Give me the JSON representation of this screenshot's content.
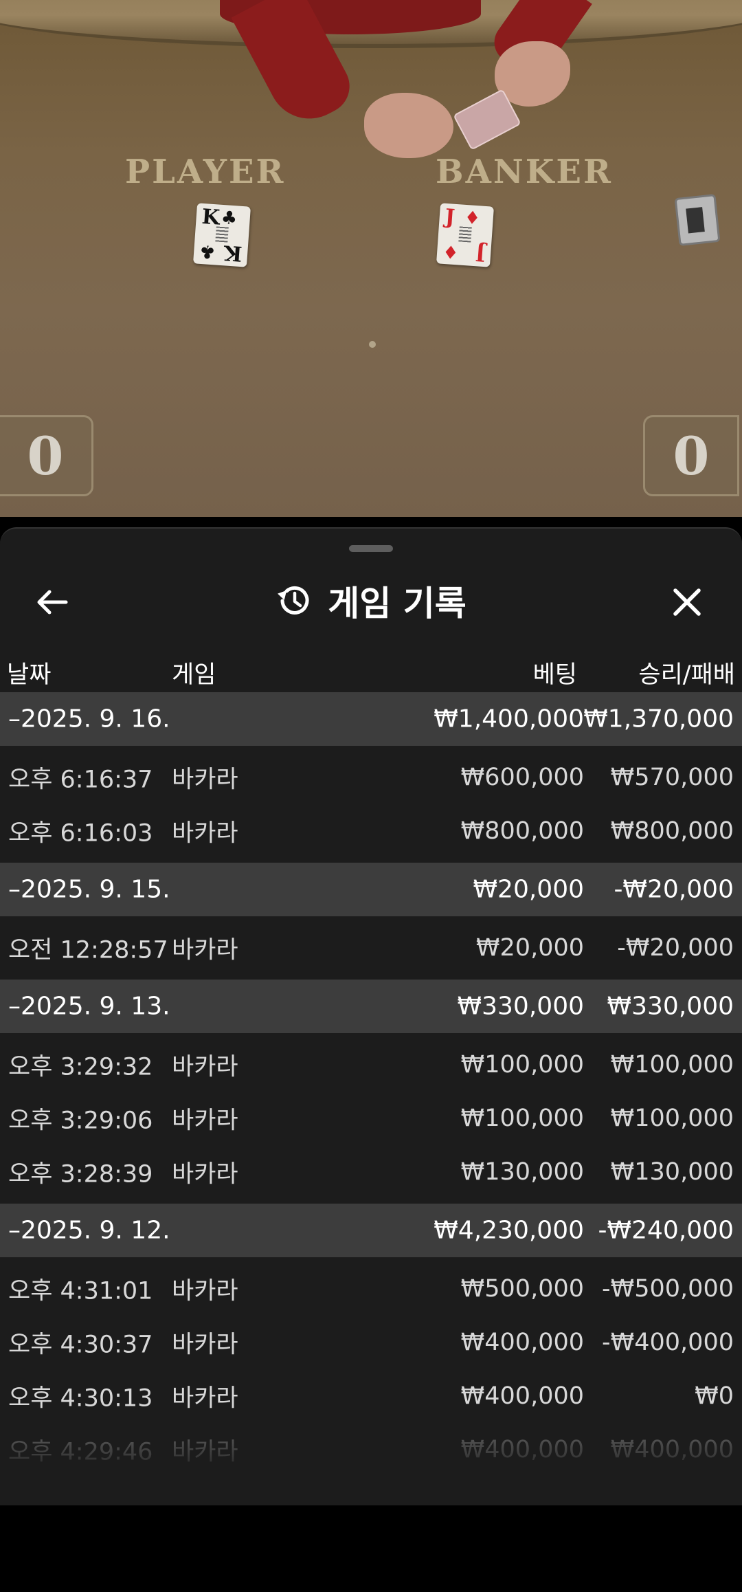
{
  "table": {
    "player_label": "PLAYER",
    "banker_label": "BANKER",
    "player_card": {
      "rank": "K",
      "suit": "♣"
    },
    "banker_card": {
      "rank": "J",
      "suit": "♦"
    },
    "player_score": "0",
    "banker_score": "0"
  },
  "sheet": {
    "title": "게임 기록",
    "back_icon": "arrow-left-icon",
    "history_icon": "history-icon",
    "close_icon": "close-icon",
    "columns": {
      "date": "날짜",
      "game": "게임",
      "bet": "베팅",
      "win_loss": "승리/패배"
    },
    "groups": [
      {
        "date": "–2025. 9. 16.",
        "bet_total": "₩1,400,000",
        "win_total": "₩1,370,000",
        "rows": [
          {
            "time": "오후 6:16:37",
            "game": "바카라",
            "bet": "₩600,000",
            "win": "₩570,000"
          },
          {
            "time": "오후 6:16:03",
            "game": "바카라",
            "bet": "₩800,000",
            "win": "₩800,000"
          }
        ]
      },
      {
        "date": "–2025. 9. 15.",
        "bet_total": "₩20,000",
        "win_total": "-₩20,000",
        "rows": [
          {
            "time": "오전 12:28:57",
            "game": "바카라",
            "bet": "₩20,000",
            "win": "-₩20,000"
          }
        ]
      },
      {
        "date": "–2025. 9. 13.",
        "bet_total": "₩330,000",
        "win_total": "₩330,000",
        "rows": [
          {
            "time": "오후 3:29:32",
            "game": "바카라",
            "bet": "₩100,000",
            "win": "₩100,000"
          },
          {
            "time": "오후 3:29:06",
            "game": "바카라",
            "bet": "₩100,000",
            "win": "₩100,000"
          },
          {
            "time": "오후 3:28:39",
            "game": "바카라",
            "bet": "₩130,000",
            "win": "₩130,000"
          }
        ]
      },
      {
        "date": "–2025. 9. 12.",
        "bet_total": "₩4,230,000",
        "win_total": "-₩240,000",
        "rows": [
          {
            "time": "오후 4:31:01",
            "game": "바카라",
            "bet": "₩500,000",
            "win": "-₩500,000"
          },
          {
            "time": "오후 4:30:37",
            "game": "바카라",
            "bet": "₩400,000",
            "win": "-₩400,000"
          },
          {
            "time": "오후 4:30:13",
            "game": "바카라",
            "bet": "₩400,000",
            "win": "₩0"
          },
          {
            "time": "오후 4:29:46",
            "game": "바카라",
            "bet": "₩400,000",
            "win": "₩400,000"
          }
        ]
      }
    ]
  }
}
